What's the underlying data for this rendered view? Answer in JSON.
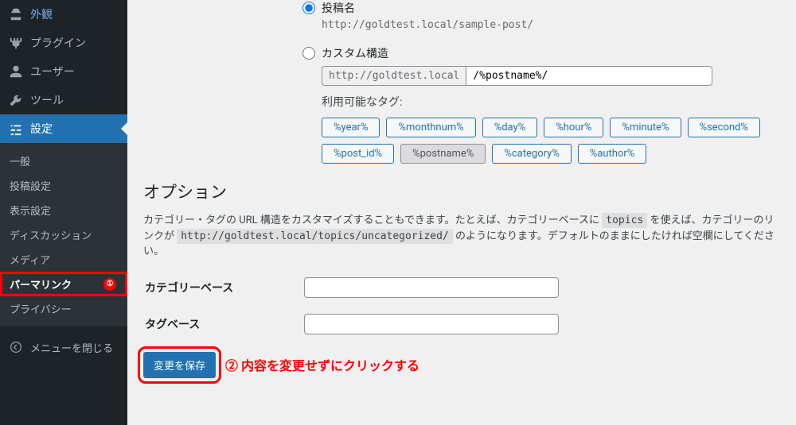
{
  "sidebar": {
    "appearance": "外観",
    "plugins": "プラグイン",
    "users": "ユーザー",
    "tools": "ツール",
    "settings": "設定",
    "submenu": {
      "general": "一般",
      "writing": "投稿設定",
      "reading": "表示設定",
      "discussion": "ディスカッション",
      "media": "メディア",
      "permalink": "パーマリンク",
      "privacy": "プライバシー"
    },
    "collapse": "メニューを閉じる",
    "annotation1": "①"
  },
  "permalink": {
    "postname_label": "投稿名",
    "postname_url": "http://goldtest.local/sample-post/",
    "custom_label": "カスタム構造",
    "custom_prefix": "http://goldtest.local",
    "custom_value": "/%postname%/",
    "tags_label": "利用可能なタグ:",
    "tags": {
      "year": "%year%",
      "monthnum": "%monthnum%",
      "day": "%day%",
      "hour": "%hour%",
      "minute": "%minute%",
      "second": "%second%",
      "post_id": "%post_id%",
      "postname": "%postname%",
      "category": "%category%",
      "author": "%author%"
    }
  },
  "options": {
    "heading": "オプション",
    "desc_part1": "カテゴリー・タグの URL 構造をカスタマイズすることもできます。たとえば、カテゴリーベースに ",
    "desc_code1": "topics",
    "desc_part2": " を使えば、カテゴリーのリンクが ",
    "desc_code2": "http://goldtest.local/topics/uncategorized/",
    "desc_part3": " のようになります。デフォルトのままにしたければ空欄にしてください。",
    "category_base_label": "カテゴリーベース",
    "tag_base_label": "タグベース",
    "category_base_value": "",
    "tag_base_value": ""
  },
  "submit": {
    "button": "変更を保存",
    "annotation": "② 内容を変更せずにクリックする"
  }
}
